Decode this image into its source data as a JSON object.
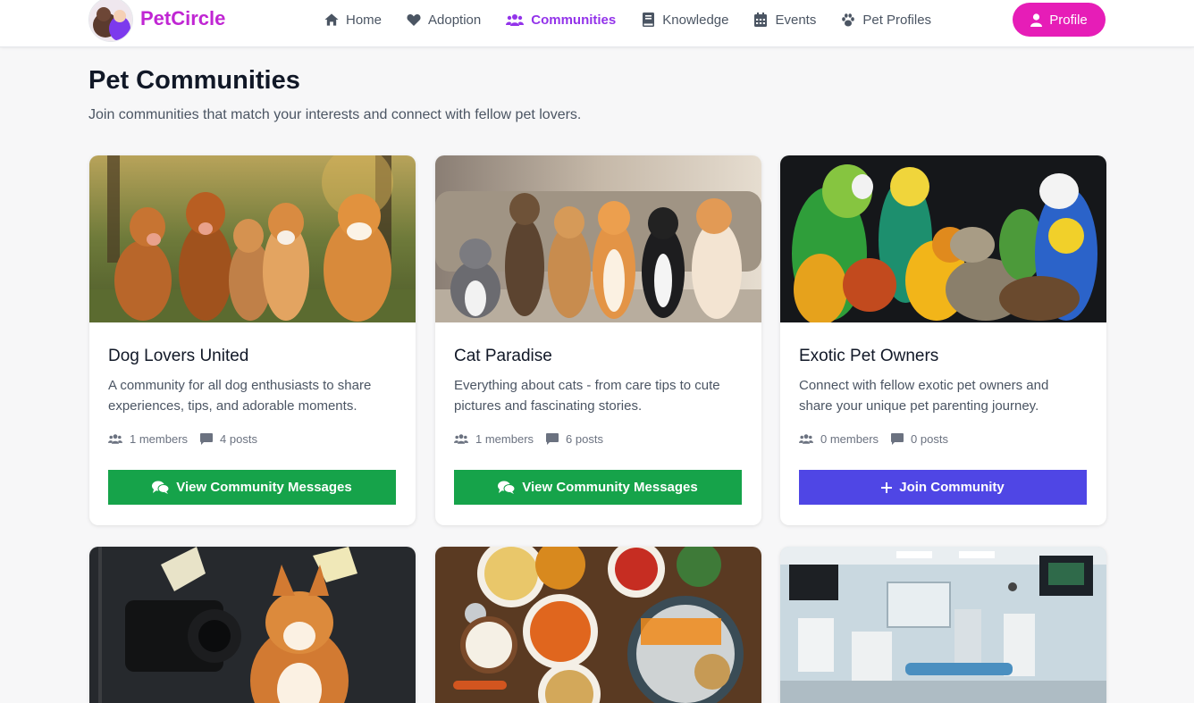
{
  "nav": {
    "brand": "PetCircle",
    "links": [
      {
        "label": "Home",
        "icon": "home-icon"
      },
      {
        "label": "Adoption",
        "icon": "heart-icon"
      },
      {
        "label": "Communities",
        "icon": "users-icon",
        "active": true
      },
      {
        "label": "Knowledge",
        "icon": "book-icon"
      },
      {
        "label": "Events",
        "icon": "calendar-icon"
      },
      {
        "label": "Pet Profiles",
        "icon": "paw-icon"
      }
    ],
    "profile_label": "Profile"
  },
  "header": {
    "title": "Pet Communities",
    "subtitle": "Join communities that match your interests and connect with fellow pet lovers."
  },
  "communities": [
    {
      "title": "Dog Lovers United",
      "description": "A community for all dog enthusiasts to share experiences, tips, and adorable moments.",
      "members": "1 members",
      "posts": "4 posts",
      "action": "View Community Messages",
      "action_type": "view"
    },
    {
      "title": "Cat Paradise",
      "description": "Everything about cats - from care tips to cute pictures and fascinating stories.",
      "members": "1 members",
      "posts": "6 posts",
      "action": "View Community Messages",
      "action_type": "view"
    },
    {
      "title": "Exotic Pet Owners",
      "description": "Connect with fellow exotic pet owners and share your unique pet parenting journey.",
      "members": "0 members",
      "posts": "0 posts",
      "action": "Join Community",
      "action_type": "join"
    }
  ],
  "colors": {
    "brand": "#c026d3",
    "active_nav": "#9333ea",
    "profile_button": "#e61db7",
    "view_button": "#16a34a",
    "join_button": "#4f46e5"
  }
}
